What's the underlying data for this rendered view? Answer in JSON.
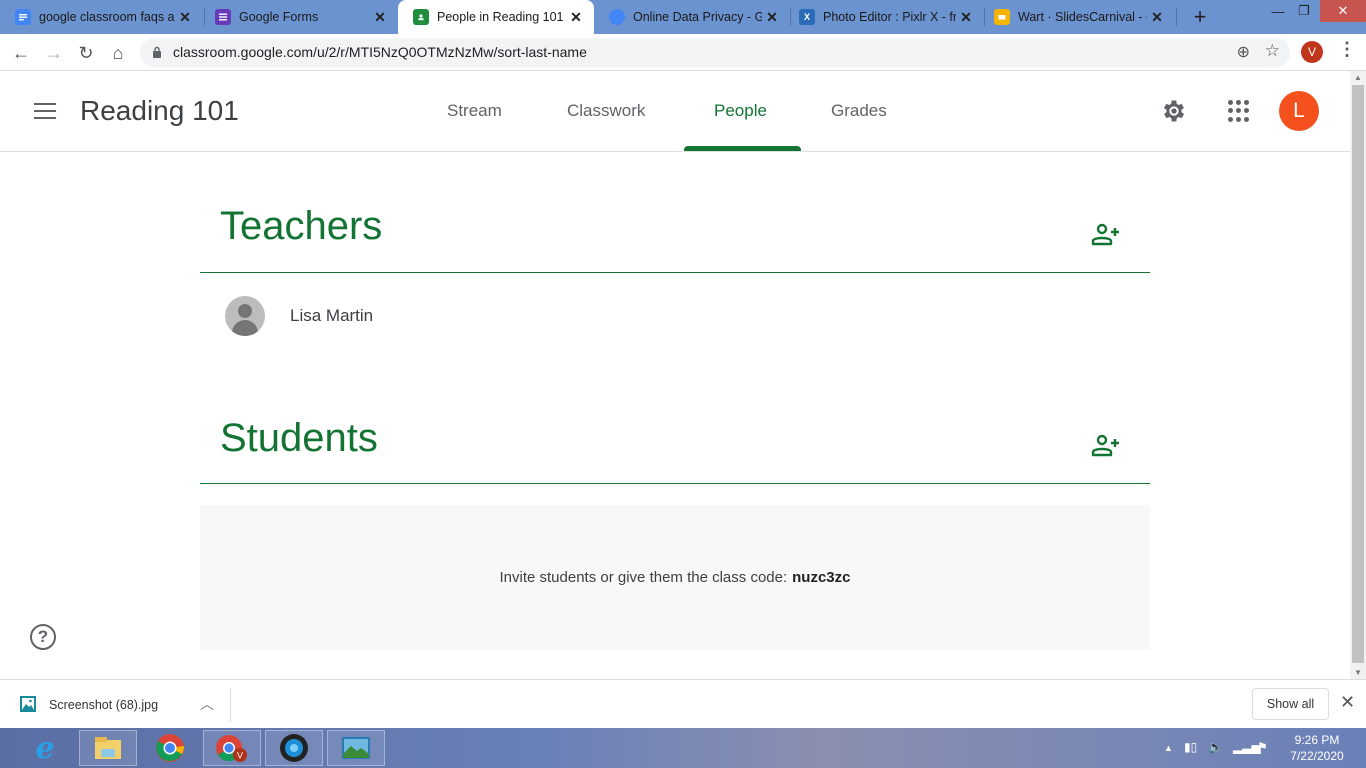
{
  "browser": {
    "tabs": [
      {
        "title": "google classroom faqs a",
        "icon": "docs-icon",
        "color": "#4285f4",
        "active": false
      },
      {
        "title": "Google Forms",
        "icon": "forms-icon",
        "color": "#673ab7",
        "active": false
      },
      {
        "title": "People in Reading 101",
        "icon": "classroom-icon",
        "color": "#1e8e3e",
        "active": true
      },
      {
        "title": "Online Data Privacy - Go",
        "icon": "privacy-icon",
        "color": "#4285f4",
        "active": false
      },
      {
        "title": "Photo Editor : Pixlr X - fr",
        "icon": "pixlr-icon",
        "color": "#2a6bb8",
        "active": false
      },
      {
        "title": "Wart · SlidesCarnival - G",
        "icon": "slides-icon",
        "color": "#f4b400",
        "active": false
      }
    ],
    "new_tab": "+",
    "url": "classroom.google.com/u/2/r/MTI5NzQ0OTMzNzMw/sort-last-name",
    "profile_initial": "V",
    "window_controls": {
      "minimize": "—",
      "restore": "❐",
      "close": "✕"
    }
  },
  "classroom": {
    "class_name": "Reading 101",
    "nav_tabs": [
      {
        "label": "Stream",
        "active": false
      },
      {
        "label": "Classwork",
        "active": false
      },
      {
        "label": "People",
        "active": true
      },
      {
        "label": "Grades",
        "active": false
      }
    ],
    "account_initial": "L",
    "accent_color": "#137333",
    "teachers": {
      "title": "Teachers",
      "people": [
        {
          "name": "Lisa Martin"
        }
      ]
    },
    "students": {
      "title": "Students",
      "invite_text": "Invite students or give them the class code:",
      "class_code": "nuzc3zc"
    },
    "help": "?"
  },
  "downloads": {
    "file_name": "Screenshot (68).jpg",
    "show_all": "Show all",
    "close": "✕"
  },
  "taskbar": {
    "apps": [
      "internet-explorer",
      "file-explorer",
      "chrome",
      "chrome-profile-v",
      "media-app",
      "photos-app"
    ],
    "time": "9:26 PM",
    "date": "7/22/2020"
  }
}
